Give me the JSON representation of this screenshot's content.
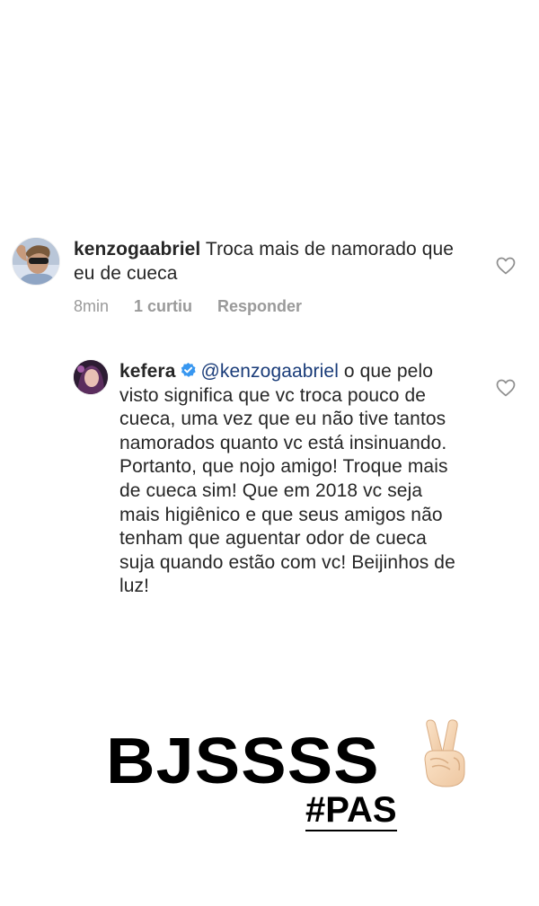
{
  "comments": [
    {
      "username": "kenzogaabriel",
      "text": " Troca mais de namorado que eu de cueca",
      "time": "8min",
      "likes": "1 curtiu",
      "reply": "Responder",
      "avatar": "user-avatar-icon",
      "like_icon": "heart-outline-icon"
    },
    {
      "username": "kefera",
      "verified_icon": "verified-badge-icon",
      "mention": "@kenzogaabriel",
      "text": " o que pelo visto significa que vc troca pouco de cueca, uma vez que eu não tive tantos namorados quanto vc está insinuando. Portanto, que nojo amigo! Troque mais de cueca sim! Que em 2018 vc seja mais higiênico e que seus amigos não tenham que aguentar odor de cueca suja quando estão com vc! Beijinhos de luz!",
      "avatar": "user-avatar-icon",
      "like_icon": "heart-outline-icon"
    }
  ],
  "sticker": {
    "text": "BJSSSS",
    "emoji_icon": "victory-hand-icon",
    "hashtag": "#PAS"
  },
  "colors": {
    "text": "#262626",
    "muted": "#9a9a9a",
    "mention": "#1a3c79",
    "verified": "#3897f0",
    "background": "#ffffff"
  }
}
